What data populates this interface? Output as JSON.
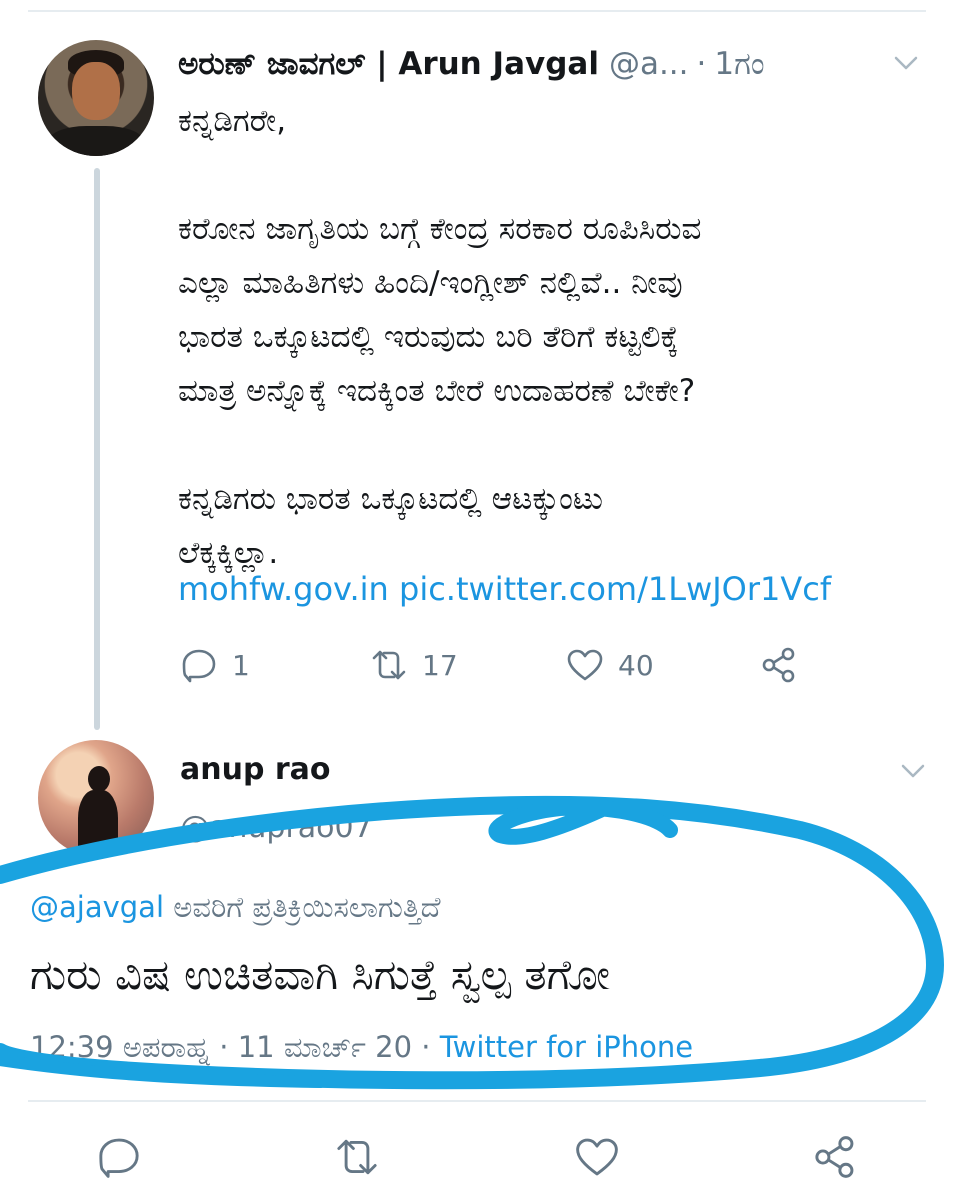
{
  "tweet": {
    "author_name": "ಅರುಣ್ ಜಾವಗಲ್ | Arun Javgal",
    "author_handle": "@a...",
    "separator": "·",
    "time_ago": "1ಗಂ",
    "lines": [
      "ಕನ್ನಡಿಗರೇ,",
      "",
      "ಕರೋನ ಜಾಗೃತಿಯ ಬಗ್ಗೆ ಕೇಂದ್ರ ಸರಕಾರ ರೂಪಿಸಿರುವ",
      "ಎಲ್ಲಾ ಮಾಹಿತಿಗಳು ಹಿಂದಿ/ಇಂಗ್ಲೀಶ್ ನಲ್ಲಿವೆ.. ನೀವು",
      "ಭಾರತ ಒಕ್ಕೂಟದಲ್ಲಿ ಇರುವುದು ಬರಿ ತೆರಿಗೆ ಕಟ್ಟಲಿಕ್ಕೆ",
      "ಮಾತ್ರ ಅನ್ನೊಕ್ಕೆ ಇದಕ್ಕಿಂತ ಬೇರೆ ಉದಾಹರಣೆ ಬೇಕೇ?",
      "",
      "ಕನ್ನಡಿಗರು ಭಾರತ ಒಕ್ಕೂಟದಲ್ಲಿ ಆಟಕ್ಕುಂಟು",
      "ಲೆಕ್ಕಕ್ಕಿಲ್ಲಾ."
    ],
    "link1": "mohfw.gov.in",
    "link2": "pic.twitter.com/1LwJOr1Vcf",
    "reply_count": "1",
    "retweet_count": "17",
    "like_count": "40"
  },
  "reply": {
    "author_name": "anup rao",
    "author_handle": "@anuprao07",
    "replying_mention": "@ajavgal",
    "replying_text": "ಅವರಿಗೆ ಪ್ರತಿಕ್ರಿಯಿಸಲಾಗುತ್ತಿದೆ",
    "text": "ಗುರು ವಿಷ ಉಚಿತವಾಗಿ ಸಿಗುತ್ತೆ ಸ್ವಲ್ಪ ತಗೋ",
    "timestamp": "12:39 ಅಪರಾಹ್ನ · 11 ಮಾರ್ಚ್ 20 ·",
    "client": "Twitter for iPhone"
  },
  "icons": {
    "reply": "reply-icon",
    "retweet": "retweet-icon",
    "like": "heart-icon",
    "share": "share-icon",
    "more": "chevron-down-icon"
  },
  "colors": {
    "link": "#1b95e0",
    "muted": "#657786",
    "annotation": "#1aa3e0"
  }
}
